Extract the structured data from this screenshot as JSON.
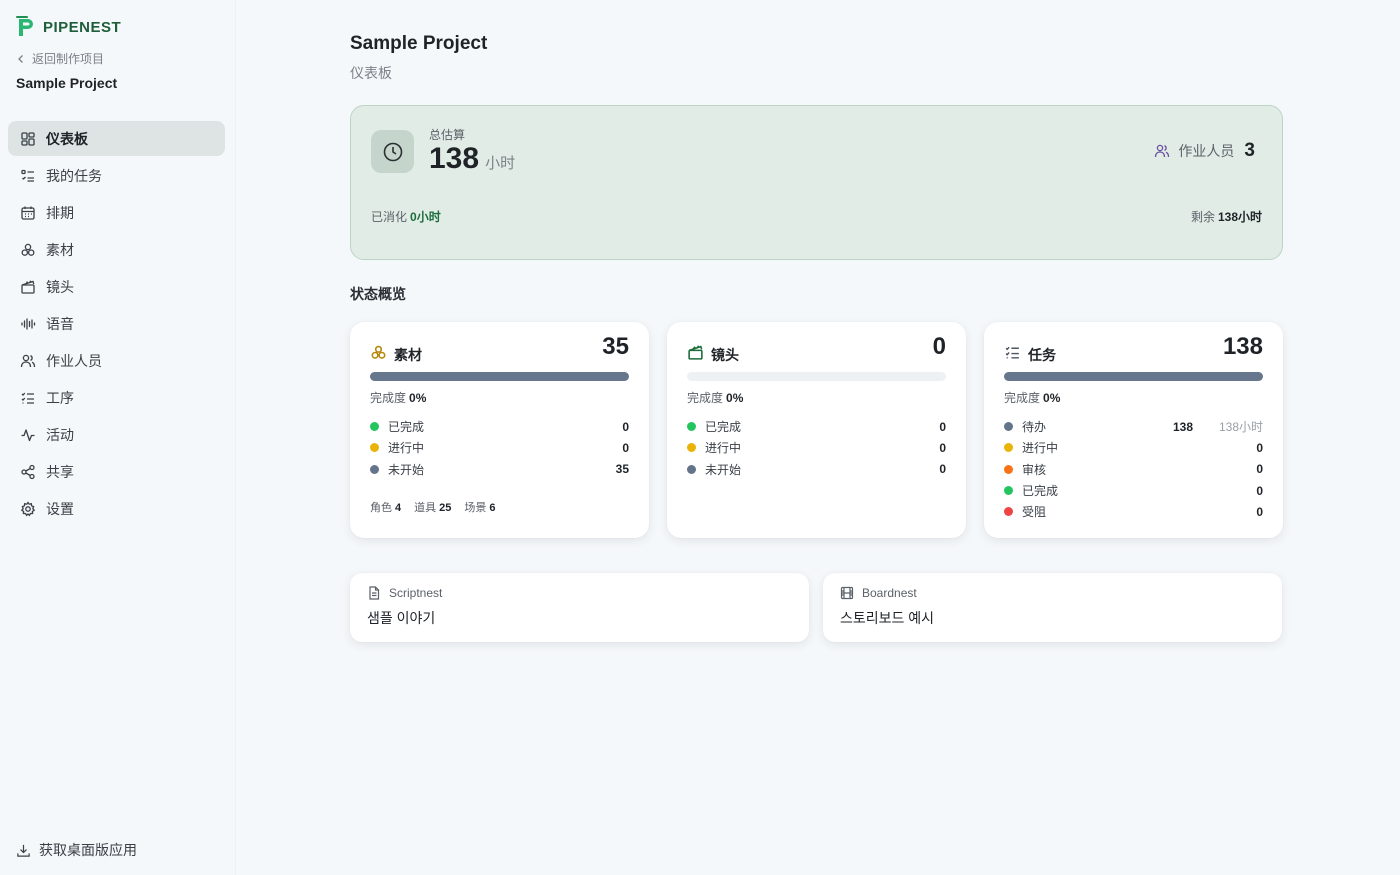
{
  "app": {
    "name": "PIPENEST"
  },
  "sidebar": {
    "back_label": "返回制作项目",
    "project_name": "Sample Project",
    "items": [
      {
        "label": "仪表板",
        "icon": "dashboard-icon",
        "active": true
      },
      {
        "label": "我的任务",
        "icon": "task-list-icon",
        "active": false
      },
      {
        "label": "排期",
        "icon": "calendar-icon",
        "active": false
      },
      {
        "label": "素材",
        "icon": "assets-icon",
        "active": false
      },
      {
        "label": "镜头",
        "icon": "clapper-icon",
        "active": false
      },
      {
        "label": "语音",
        "icon": "audio-wave-icon",
        "active": false
      },
      {
        "label": "作业人员",
        "icon": "users-icon",
        "active": false
      },
      {
        "label": "工序",
        "icon": "list-check-icon",
        "active": false
      },
      {
        "label": "活动",
        "icon": "activity-icon",
        "active": false
      },
      {
        "label": "共享",
        "icon": "share-icon",
        "active": false
      },
      {
        "label": "设置",
        "icon": "gear-icon",
        "active": false
      }
    ],
    "download_label": "获取桌面版应用"
  },
  "header": {
    "title": "Sample Project",
    "subtitle": "仪表板"
  },
  "estimate": {
    "label": "总估算",
    "value": "138",
    "unit": "小时",
    "workers_label": "作业人员",
    "workers_count": "3",
    "consumed_label": "已消化",
    "consumed_value": "0小时",
    "remaining_label": "剩余",
    "remaining_value": "138小时"
  },
  "overview": {
    "title": "状态概览",
    "cards": [
      {
        "title": "素材",
        "total": "35",
        "icon": "assets-icon",
        "icon_color": "#b8860b",
        "completion_label": "完成度",
        "completion_value": "0%",
        "progress": 0,
        "statuses": [
          {
            "label": "已完成",
            "count": "0",
            "color": "#22c55e"
          },
          {
            "label": "进行中",
            "count": "0",
            "color": "#eab308"
          },
          {
            "label": "未开始",
            "count": "35",
            "color": "#64748b"
          }
        ],
        "breakdown": [
          {
            "label": "角色",
            "value": "4"
          },
          {
            "label": "道具",
            "value": "25"
          },
          {
            "label": "场景",
            "value": "6"
          }
        ]
      },
      {
        "title": "镜头",
        "total": "0",
        "icon": "clapper-icon",
        "icon_color": "#1b6d3a",
        "completion_label": "完成度",
        "completion_value": "0%",
        "progress": 0,
        "statuses": [
          {
            "label": "已完成",
            "count": "0",
            "color": "#22c55e"
          },
          {
            "label": "进行中",
            "count": "0",
            "color": "#eab308"
          },
          {
            "label": "未开始",
            "count": "0",
            "color": "#64748b"
          }
        ]
      },
      {
        "title": "任务",
        "total": "138",
        "icon": "list-check-icon",
        "icon_color": "#4b5563",
        "completion_label": "完成度",
        "completion_value": "0%",
        "progress": 0,
        "statuses": [
          {
            "label": "待办",
            "count": "138",
            "hours": "138小时",
            "color": "#64748b"
          },
          {
            "label": "进行中",
            "count": "0",
            "color": "#eab308"
          },
          {
            "label": "审核",
            "count": "0",
            "color": "#f97316"
          },
          {
            "label": "已完成",
            "count": "0",
            "color": "#22c55e"
          },
          {
            "label": "受阻",
            "count": "0",
            "color": "#ef4444"
          }
        ]
      }
    ]
  },
  "links": [
    {
      "app": "Scriptnest",
      "icon": "document-icon",
      "name": "샘플 이야기"
    },
    {
      "app": "Boardnest",
      "icon": "film-icon",
      "name": "스토리보드 예시"
    }
  ],
  "colors": {
    "brand": "#1b6d3a",
    "estimate_bg": "#e2ece6",
    "progress": "#66768d"
  }
}
